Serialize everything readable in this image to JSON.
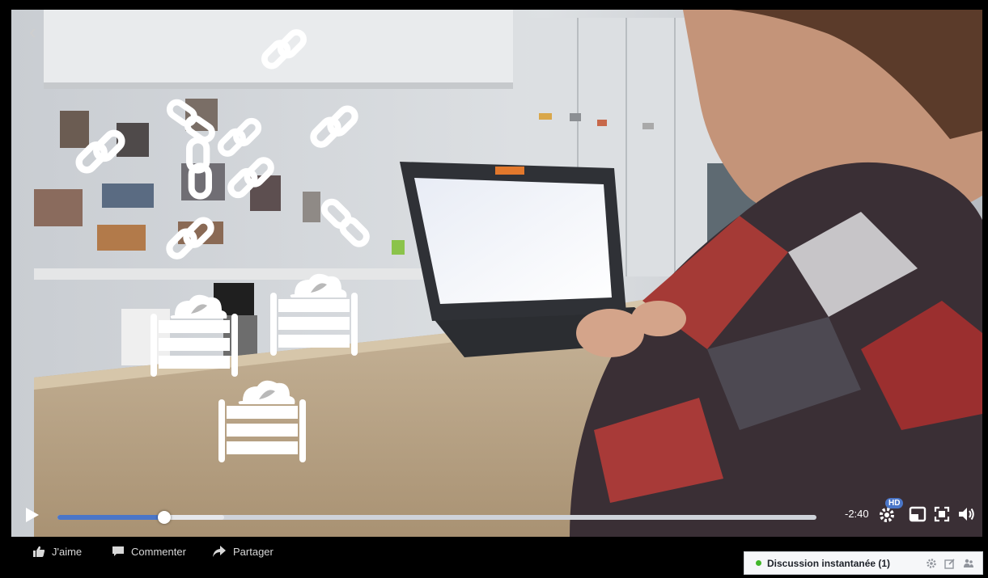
{
  "player": {
    "back_icon": "chevron-left-icon",
    "overlay_icons": [
      "chain-link-icon",
      "crate-cloud-icon"
    ],
    "controls": {
      "play_icon": "play-icon",
      "progress": {
        "played_fraction": 0.141,
        "buffered_fraction": 0.22
      },
      "time_remaining": "-2:40",
      "hd_badge": "HD",
      "settings_icon": "gear-icon",
      "miniplayer_icon": "miniplayer-icon",
      "fullscreen_icon": "fullscreen-icon",
      "volume_icon": "volume-icon"
    }
  },
  "actions": {
    "like_label": "J'aime",
    "comment_label": "Commenter",
    "share_label": "Partager"
  },
  "chat": {
    "label": "Discussion instantanée (1)",
    "status_color": "#42b72a"
  },
  "colors": {
    "accent": "#4a76c8",
    "background": "#000000"
  }
}
